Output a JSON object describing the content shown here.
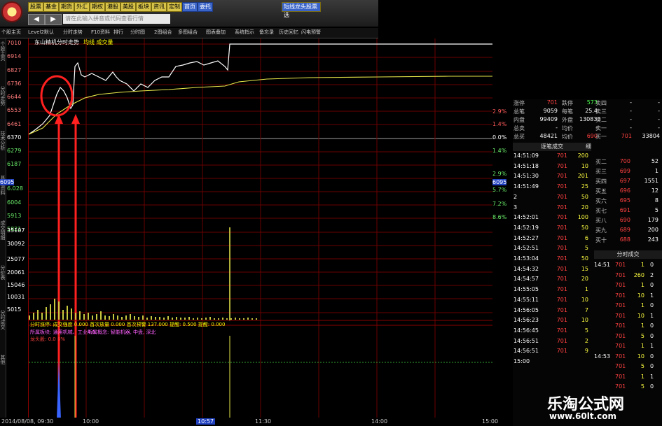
{
  "toolbar": {
    "buttons": [
      "股票",
      "基金",
      "期货",
      "外汇",
      "期权",
      "港股",
      "美股",
      "板块",
      "资讯",
      "定制",
      "首页",
      "委托"
    ],
    "search_placeholder": "请在此输入拼音或代码查看行情",
    "promo": "短线龙头股票选"
  },
  "tabs": [
    "个股主页",
    "Level2默认",
    "分时走势",
    "F10资料",
    "排行",
    "分时图",
    "2图组合",
    "多图组合",
    "图表叠加",
    "系统指示",
    "备忘录",
    "历史回忆",
    "闪电预警"
  ],
  "vtabs": [
    "个股主页",
    "分时走势",
    "技术分析",
    "基本资料",
    "成交明细",
    "分价表",
    "分时成交",
    "其他"
  ],
  "chart": {
    "title": "东山精机分时走势",
    "legend": "均线 成交量",
    "price_labels": [
      "7010",
      "6914",
      "6827",
      "6736",
      "6644",
      "6553",
      "6461",
      "6370",
      "6279",
      "6187",
      "6095",
      "6.028",
      "6004",
      "5913",
      "5821"
    ],
    "pct_labels": [
      "2.9%",
      "1.4%",
      "0.0%",
      "1.4%",
      "2.9%",
      "5.7%",
      "7.2%",
      "8.6%"
    ],
    "vol_labels": [
      "35107",
      "30092",
      "25077",
      "20061",
      "15046",
      "10031",
      "5015"
    ],
    "footer_text": "分时涨停: 成交强度 0.000 首次放量 0.000 首次预警 137.000 提醒: 0.500 提醒: 0.000",
    "sub_label1": "所属板块: 通用机械、工业4.0",
    "sub_label2": "所属概念: 智能机器, 中盘, 深北",
    "sub_label3": "龙头股: 0.0 6%",
    "time_labels": [
      "2014/08/08, 09:30",
      "10:00",
      "10:57",
      "11:30",
      "14:00",
      "15:00"
    ]
  },
  "panel": {
    "top_rows": [
      {
        "a": "涨停",
        "b": "701",
        "c": "跌停",
        "d": "573",
        "e": "卖四",
        "f": "-",
        "g": "-"
      },
      {
        "a": "总笔",
        "b": "9059",
        "c": "每笔",
        "d": "25.4",
        "e": "卖三",
        "f": "-",
        "g": "-"
      },
      {
        "a": "内盘",
        "b": "99409",
        "c": "外盘",
        "d": "130833",
        "e": "卖二",
        "f": "-",
        "g": "-"
      },
      {
        "a": "总卖",
        "b": "-",
        "c": "均价",
        "d": "-",
        "e": "卖一",
        "f": "-",
        "g": "-"
      },
      {
        "a": "总买",
        "b": "48421",
        "c": "均价",
        "d": "690",
        "e": "买一",
        "f": "701",
        "g": "33804"
      }
    ],
    "detail_header": "逐笔成交",
    "detail_tab": "细",
    "detail_rows": [
      [
        "14:51:09",
        "701",
        "200"
      ],
      [
        "14:51:18",
        "701",
        "10"
      ],
      [
        "14:51:30",
        "701",
        "201"
      ],
      [
        "14:51:49",
        "701",
        "25"
      ],
      [
        "2",
        "701",
        "50"
      ],
      [
        "3",
        "701",
        "20"
      ],
      [
        "14:52:01",
        "701",
        "100"
      ],
      [
        "14:52:19",
        "701",
        "50"
      ],
      [
        "14:52:27",
        "701",
        "6"
      ],
      [
        "14:52:51",
        "701",
        "5"
      ],
      [
        "14:53:04",
        "701",
        "50"
      ],
      [
        "14:54:32",
        "701",
        "15"
      ],
      [
        "14:54:57",
        "701",
        "20"
      ],
      [
        "14:55:05",
        "701",
        "1"
      ],
      [
        "14:55:11",
        "701",
        "10"
      ],
      [
        "14:56:05",
        "701",
        "7"
      ],
      [
        "14:56:23",
        "701",
        "10"
      ],
      [
        "14:56:45",
        "701",
        "5"
      ],
      [
        "14:56:51",
        "701",
        "2"
      ],
      [
        "14:56:51",
        "701",
        "9"
      ],
      [
        "15:00",
        "",
        ""
      ]
    ],
    "buy_levels": [
      [
        "买二",
        "700",
        "52"
      ],
      [
        "买三",
        "699",
        "1"
      ],
      [
        "买四",
        "697",
        "1551"
      ],
      [
        "买五",
        "696",
        "12"
      ],
      [
        "买六",
        "695",
        "8"
      ],
      [
        "买七",
        "691",
        "5"
      ],
      [
        "买八",
        "690",
        "179"
      ],
      [
        "买九",
        "689",
        "200"
      ],
      [
        "买十",
        "688",
        "243"
      ]
    ],
    "fs_header": "分时成交",
    "fs_rows": [
      [
        "14:51",
        "701",
        "1",
        "0"
      ],
      [
        "",
        "701",
        "260",
        "2"
      ],
      [
        "",
        "701",
        "1",
        "0"
      ],
      [
        "",
        "701",
        "10",
        "1"
      ],
      [
        "",
        "701",
        "1",
        "0"
      ],
      [
        "",
        "701",
        "10",
        "1"
      ],
      [
        "",
        "701",
        "1",
        "0"
      ],
      [
        "",
        "701",
        "5",
        "0"
      ],
      [
        "",
        "701",
        "1",
        "1"
      ],
      [
        "14:53",
        "701",
        "10",
        "0"
      ],
      [
        "",
        "701",
        "5",
        "0"
      ],
      [
        "",
        "701",
        "1",
        "1"
      ],
      [
        "",
        "701",
        "5",
        "0"
      ]
    ]
  },
  "watermark": {
    "title": "乐淘公式网",
    "url": "www.60lt.com"
  }
}
